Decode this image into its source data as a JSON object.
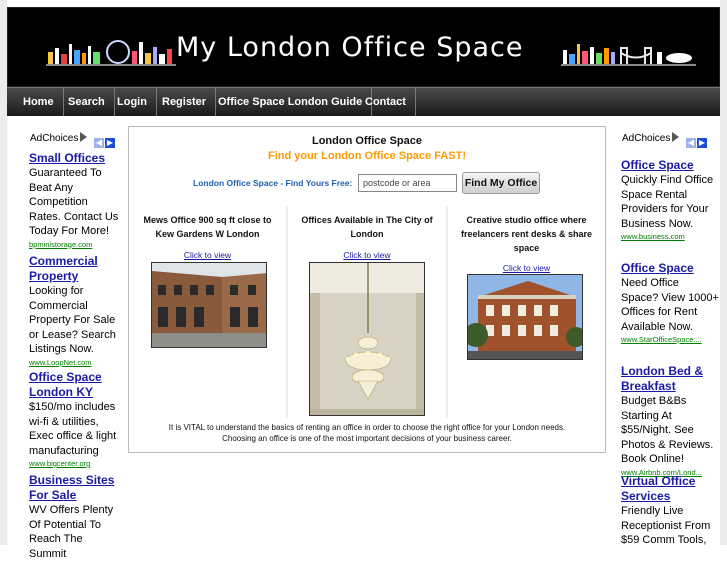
{
  "header": {
    "title": "My London Office Space"
  },
  "nav": [
    "Home",
    "Search",
    "Login",
    "Register",
    "Office Space London Guide",
    "Contact"
  ],
  "adchoices_label": "AdChoices",
  "left_ads": [
    {
      "title": "Small Offices",
      "text": "Guaranteed To Beat Any Competition Rates. Contact Us Today For More!",
      "url": "bpministorage.com"
    },
    {
      "title": "Commercial Property",
      "text": "Looking for Commercial Property For Sale or Lease? Search Listings Now.",
      "url": "www.LoopNet.com"
    },
    {
      "title": "Office Space London KY",
      "text": "$150/mo includes wi-fi & utilities, Exec office & light manufacturing",
      "url": "www.bigcenter.org"
    },
    {
      "title": "Business Sites For Sale",
      "text": "WV Offers Plenty Of Potential To Reach The Summit",
      "url": ""
    }
  ],
  "right_ads": [
    {
      "title": "Office Space",
      "text": "Quickly Find Office Space Rental Providers for Your Business Now.",
      "url": "www.business.com"
    },
    {
      "title": "Office Space",
      "text": "Need Office Space? View 1000+ Offices for Rent Available Now.",
      "url": "www.StarOfficeSpace...."
    },
    {
      "title": "London Bed & Breakfast",
      "text": "Budget B&Bs Starting At $55/Night. See Photos & Reviews. Book Online!",
      "url": "www.Airbnb.com/Lond..."
    },
    {
      "title": "Virtual Office Services",
      "text": "Friendly Live Receptionist From $59 Comm Tools,",
      "url": ""
    }
  ],
  "main": {
    "heading": "London Office Space",
    "subheading": "Find your London Office Space FAST!",
    "search_label": "London Office Space - Find Yours Free:",
    "search_value": "postcode or area",
    "search_button": "Find My Office",
    "listings": [
      {
        "title": "Mews Office 900 sq ft close to Kew Gardens W London",
        "link": "Click to view"
      },
      {
        "title": "Offices Available in The City of London",
        "link": "Click to view"
      },
      {
        "title": "Creative studio office where freelancers rent desks & share space",
        "link": "Click to view"
      }
    ],
    "vital_line1": "It is VITAL to understand the basics of renting an office in order to choose the right office for your London needs.",
    "vital_line2": "Choosing an office is one of the most important decisions of your business career."
  }
}
